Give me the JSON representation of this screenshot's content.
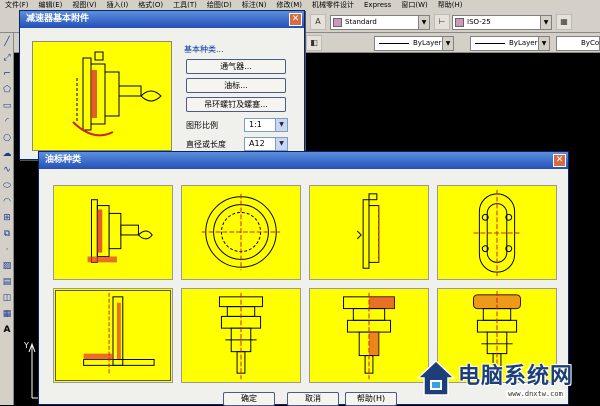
{
  "menubar": [
    "文件(F)",
    "编辑(E)",
    "视图(V)",
    "插入(I)",
    "格式(O)",
    "工具(T)",
    "绘图(D)",
    "标注(N)",
    "修改(M)",
    "机械零件设计",
    "Express",
    "窗口(W)",
    "帮助(H)"
  ],
  "toolbar": {
    "text_style": "Standard",
    "dim_style": "ISO-25",
    "linetype1": "ByLayer",
    "linetype2": "ByLayer",
    "linetype3": "ByCo"
  },
  "dialog1": {
    "title": "减速器基本附件",
    "group_label": "基本种类...",
    "buttons": [
      "通气器...",
      "油标...",
      "吊环螺钉及螺塞..."
    ],
    "scale_label": "图形比例",
    "scale_value": "1:1",
    "size_label": "直径或长度",
    "size_value": "A12"
  },
  "dialog2": {
    "title": "油标种类",
    "ok": "确定",
    "cancel": "取消",
    "help": "帮助(H)"
  },
  "watermark": {
    "name": "电脑系统网",
    "url": "www.dnxtw.com"
  },
  "colors": {
    "preview_bg": "#ffff00",
    "drawing_bg": "#000000",
    "title_blue": "#2350b8"
  }
}
